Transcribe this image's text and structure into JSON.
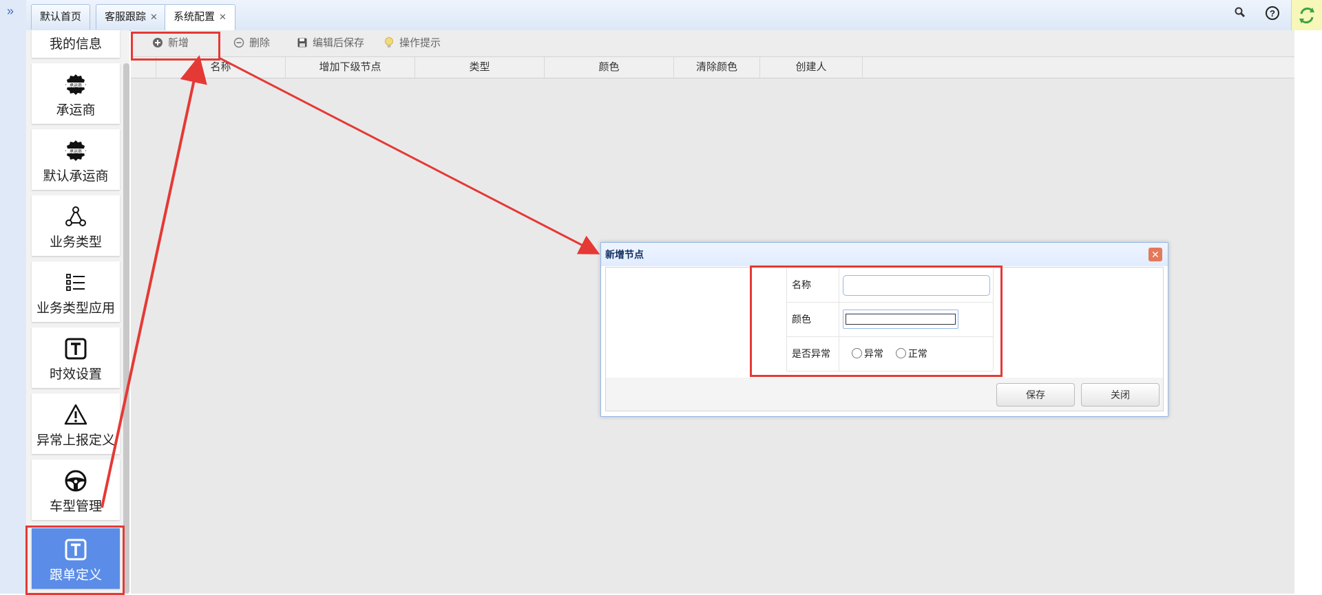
{
  "tabs": [
    {
      "label": "默认首页",
      "closable": false
    },
    {
      "label": "客服跟踪",
      "closable": true
    },
    {
      "label": "系统配置",
      "closable": true,
      "active": true
    }
  ],
  "top_icons": [
    "search-icon",
    "help-icon",
    "refresh-icon"
  ],
  "sidebar": {
    "items": [
      {
        "label": "我的信息",
        "icon": "none"
      },
      {
        "label": "承运商",
        "icon": "carrier-badge-icon"
      },
      {
        "label": "默认承运商",
        "icon": "carrier-badge-icon"
      },
      {
        "label": "业务类型",
        "icon": "network-icon"
      },
      {
        "label": "业务类型应用",
        "icon": "list-icon"
      },
      {
        "label": "时效设置",
        "icon": "text-box-icon"
      },
      {
        "label": "异常上报定义",
        "icon": "warning-icon"
      },
      {
        "label": "车型管理",
        "icon": "steering-wheel-icon"
      },
      {
        "label": "跟单定义",
        "icon": "text-box-icon",
        "active": true
      }
    ],
    "badge_text": "承运商"
  },
  "toolbar": {
    "add": "新增",
    "delete": "删除",
    "save_after_edit": "编辑后保存",
    "tips": "操作提示"
  },
  "grid": {
    "columns": [
      "名称",
      "增加下级节点",
      "类型",
      "颜色",
      "清除颜色",
      "创建人"
    ]
  },
  "dialog": {
    "title": "新增节点",
    "fields": {
      "name_label": "名称",
      "name_value": "",
      "color_label": "颜色",
      "color_value": "",
      "abnormal_label": "是否异常",
      "option_abnormal": "异常",
      "option_normal": "正常"
    },
    "save": "保存",
    "close": "关闭"
  },
  "colors": {
    "accent": "#5b8de8",
    "annotation": "#e53935",
    "dialog_border": "#95b8e7"
  }
}
